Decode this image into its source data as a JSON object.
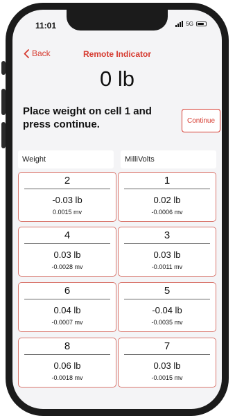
{
  "status_bar": {
    "time": "11:01",
    "network": "5G"
  },
  "nav": {
    "back_label": "Back",
    "title": "Remote Indicator"
  },
  "main": {
    "weight_display": "0 lb",
    "instruction": "Place weight on cell 1 and press continue.",
    "continue_label": "Continue",
    "col_weight": "Weight",
    "col_millivolts": "MilliVolts"
  },
  "cells": [
    {
      "number": "2",
      "weight": "-0.03 lb",
      "mv": "0.0015 mv"
    },
    {
      "number": "1",
      "weight": "0.02 lb",
      "mv": "-0.0006 mv"
    },
    {
      "number": "4",
      "weight": "0.03 lb",
      "mv": "-0.0028 mv"
    },
    {
      "number": "3",
      "weight": "0.03 lb",
      "mv": "-0.0011 mv"
    },
    {
      "number": "6",
      "weight": "0.04 lb",
      "mv": "-0.0007 mv"
    },
    {
      "number": "5",
      "weight": "-0.04 lb",
      "mv": "-0.0035 mv"
    },
    {
      "number": "8",
      "weight": "0.06 lb",
      "mv": "-0.0018 mv"
    },
    {
      "number": "7",
      "weight": "0.03 lb",
      "mv": "-0.0015 mv"
    }
  ],
  "colors": {
    "accent": "#d63a2f",
    "card_border": "#d9766d",
    "screen_bg": "#f4f4f6",
    "frame": "#1b1b1b"
  },
  "icons": {
    "back": "chevron-left-icon",
    "signal": "signal-bars-icon",
    "battery": "battery-icon"
  }
}
